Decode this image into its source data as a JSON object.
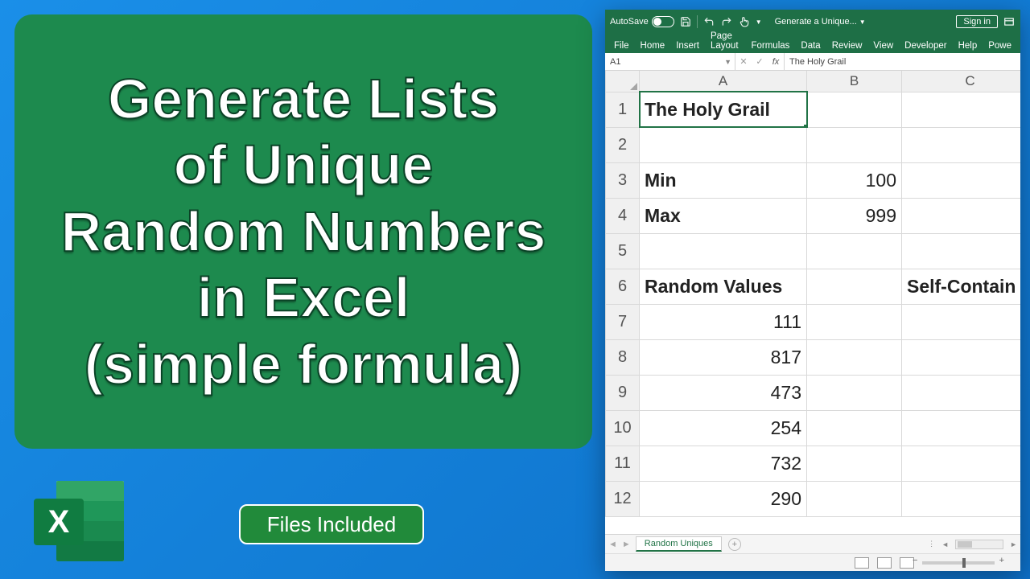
{
  "title_panel": {
    "line1": "Generate Lists",
    "line2": "of Unique",
    "line3": "Random Numbers",
    "line4": "in Excel",
    "line5": "(simple formula)"
  },
  "files_pill": "Files Included",
  "excel_logo_letter": "X",
  "titlebar": {
    "autosave_label": "AutoSave",
    "autosave_state": "Off",
    "doc_title": "Generate a Unique...",
    "signin": "Sign in"
  },
  "ribbon": {
    "tabs": [
      "File",
      "Home",
      "Insert",
      "Page Layout",
      "Formulas",
      "Data",
      "Review",
      "View",
      "Developer",
      "Help",
      "Powe"
    ]
  },
  "formula_bar": {
    "name_box": "A1",
    "fx_label": "fx",
    "formula_value": "The Holy Grail"
  },
  "sheet": {
    "col_headers": [
      "A",
      "B",
      "C"
    ],
    "rows": [
      {
        "n": "1",
        "a": "The Holy Grail",
        "b": "",
        "c": "",
        "a_bold": true,
        "sel": true
      },
      {
        "n": "2",
        "a": "",
        "b": "",
        "c": ""
      },
      {
        "n": "3",
        "a": "Min",
        "b": "100",
        "c": "",
        "a_bold": true,
        "b_num": true
      },
      {
        "n": "4",
        "a": "Max",
        "b": "999",
        "c": "",
        "a_bold": true,
        "b_num": true
      },
      {
        "n": "5",
        "a": "",
        "b": "",
        "c": ""
      },
      {
        "n": "6",
        "a": "Random Values",
        "b": "",
        "c": "Self-Contain",
        "a_bold": true,
        "c_bold": true
      },
      {
        "n": "7",
        "a": "111",
        "b": "",
        "c": "",
        "a_num": true
      },
      {
        "n": "8",
        "a": "817",
        "b": "",
        "c": "",
        "a_num": true
      },
      {
        "n": "9",
        "a": "473",
        "b": "",
        "c": "",
        "a_num": true
      },
      {
        "n": "10",
        "a": "254",
        "b": "",
        "c": "",
        "a_num": true
      },
      {
        "n": "11",
        "a": "732",
        "b": "",
        "c": "",
        "a_num": true
      },
      {
        "n": "12",
        "a": "290",
        "b": "",
        "c": "",
        "a_num": true
      }
    ]
  },
  "sheet_tabs": {
    "active": "Random Uniques"
  }
}
